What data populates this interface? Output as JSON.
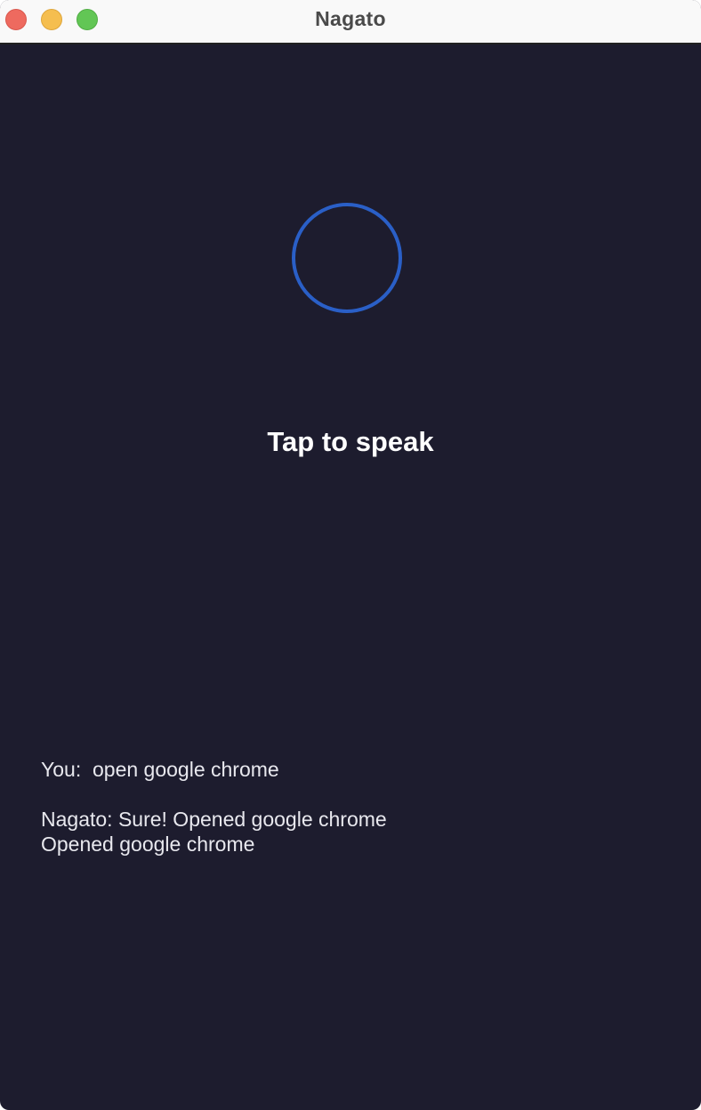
{
  "window": {
    "title": "Nagato"
  },
  "main": {
    "tap_label": "Tap to speak"
  },
  "transcript": {
    "user_message": "You:  open google chrome",
    "assistant_message": "Nagato: Sure! Opened google chrome\nOpened google chrome"
  },
  "colors": {
    "background": "#1d1c2e",
    "ring": "#2a5fc7",
    "titlebar": "#f9f9f9",
    "close": "#ee6a5f",
    "minimize": "#f5be4f",
    "maximize": "#62c655"
  }
}
